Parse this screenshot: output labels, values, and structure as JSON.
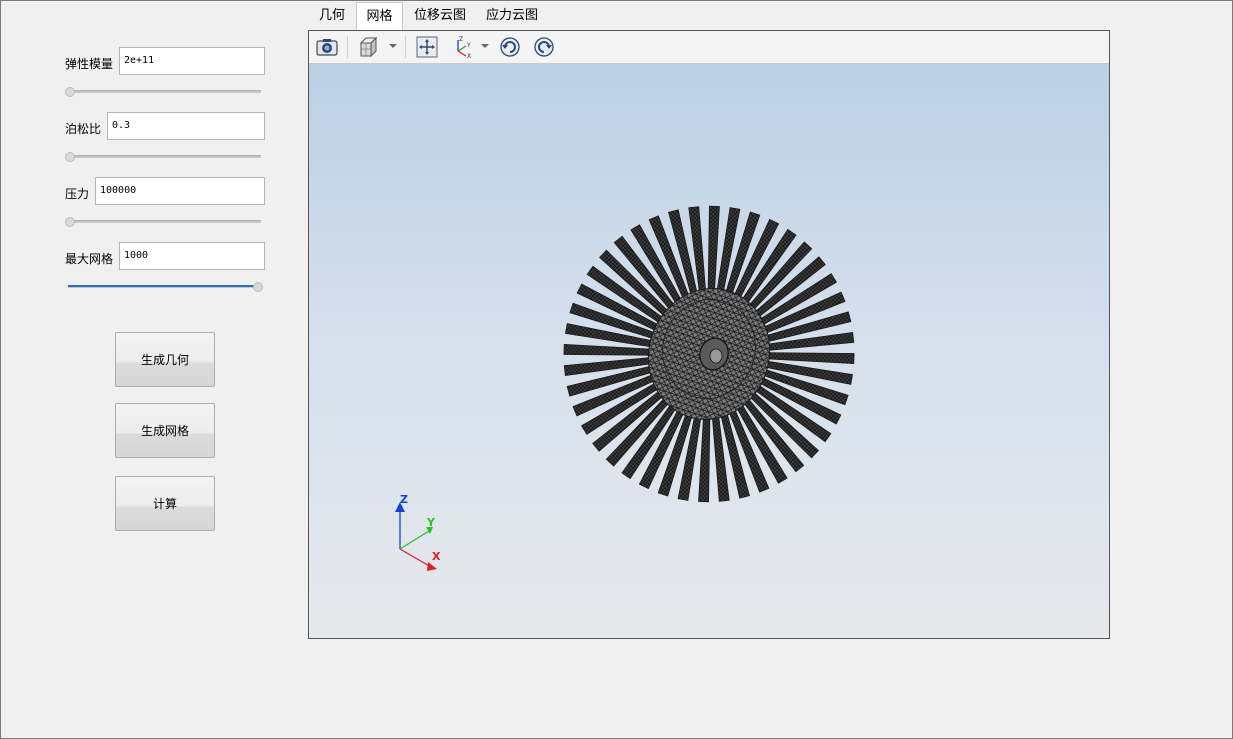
{
  "params": {
    "youngs_modulus": {
      "label": "弹性模量",
      "value": "2e+11",
      "slider_fraction": 0.0
    },
    "poisson_ratio": {
      "label": "泊松比",
      "value": "0.3",
      "slider_fraction": 0.0
    },
    "pressure": {
      "label": "压力",
      "value": "100000",
      "slider_fraction": 0.0
    },
    "max_mesh": {
      "label": "最大网格",
      "value": "1000",
      "slider_fraction": 1.0
    }
  },
  "buttons": {
    "generate_geometry": "生成几何",
    "generate_mesh": "生成网格",
    "compute": "计算"
  },
  "tabs": [
    {
      "label": "几何",
      "active": false
    },
    {
      "label": "网格",
      "active": true
    },
    {
      "label": "位移云图",
      "active": false
    },
    {
      "label": "应力云图",
      "active": false
    }
  ],
  "toolbar": {
    "icons": [
      "camera-icon",
      "view-cube-icon",
      "fit-all-icon",
      "axes-icon",
      "rotate-cw-icon",
      "rotate-ccw-icon"
    ]
  },
  "axes_triad": {
    "x": "X",
    "y": "Y",
    "z": "Z"
  },
  "colors": {
    "axis_x": "#e02020",
    "axis_y": "#22c522",
    "axis_z": "#1a3fd6",
    "mesh": "#1a1a1a",
    "slider_accent": "#2b6fbf"
  }
}
